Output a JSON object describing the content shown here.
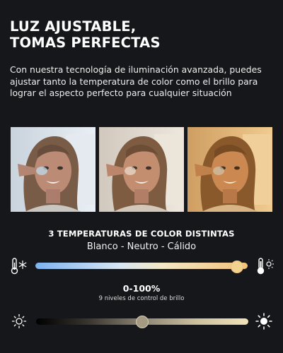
{
  "headline": {
    "line1": "LUZ AJUSTABLE,",
    "line2": "TOMAS PERFECTAS"
  },
  "intro": "Con nuestra tecnología de iluminación avanzada, puedes ajustar tanto la temperatura de color como el brillo para lograr el aspecto perfecto para cualquier situación",
  "photos": [
    {
      "tone": "white",
      "overlay": "#cfe0f0"
    },
    {
      "tone": "neutral",
      "overlay": "#efe0cc"
    },
    {
      "tone": "warm",
      "overlay": "#f3b564"
    }
  ],
  "temperature": {
    "title": "3 TEMPERATURAS DE COLOR DISTINTAS",
    "subtitle": "Blanco - Neutro - Cálido",
    "cold_icon": "thermometer-snowflake-icon",
    "warm_icon": "thermometer-sun-icon",
    "level": 0.95
  },
  "brightness": {
    "title": "0-100%",
    "subtitle": "9 niveles de control de brillo",
    "dim_icon": "dim-sun-icon",
    "bright_icon": "bright-sun-icon",
    "level": 0.5
  }
}
